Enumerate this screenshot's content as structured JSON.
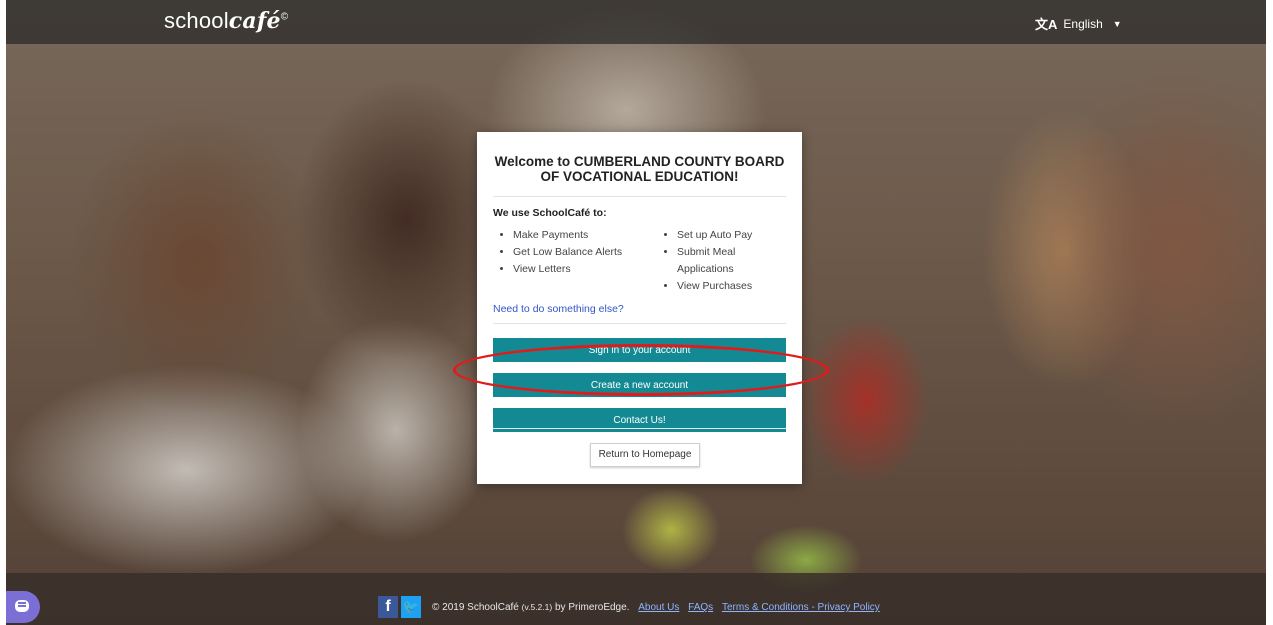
{
  "header": {
    "logo_text": "school",
    "logo_accent": "café",
    "language_label": "English"
  },
  "card": {
    "title": "Welcome to CUMBERLAND COUNTY BOARD OF VOCATIONAL EDUCATION!",
    "uses_label": "We use SchoolCafé to:",
    "features_left": [
      "Make Payments",
      "Get Low Balance Alerts",
      "View Letters"
    ],
    "features_right": [
      "Set up Auto Pay",
      "Submit Meal Applications",
      "View Purchases"
    ],
    "other_link": "Need to do something else?",
    "sign_in_label": "Sign in to your account",
    "create_account_label": "Create a new account",
    "contact_label": "Contact Us!",
    "return_label": "Return to Homepage"
  },
  "footer": {
    "copyright_prefix": "© 2019 SchoolCafé",
    "version": "(v.5.2.1)",
    "copyright_suffix": "by PrimeroEdge.",
    "links": [
      "About Us",
      "FAQs",
      "Terms & Conditions - Privacy Policy"
    ]
  },
  "colors": {
    "primary_button": "#138a93",
    "highlight_ring": "#e21a1a",
    "link": "#3355cc"
  }
}
